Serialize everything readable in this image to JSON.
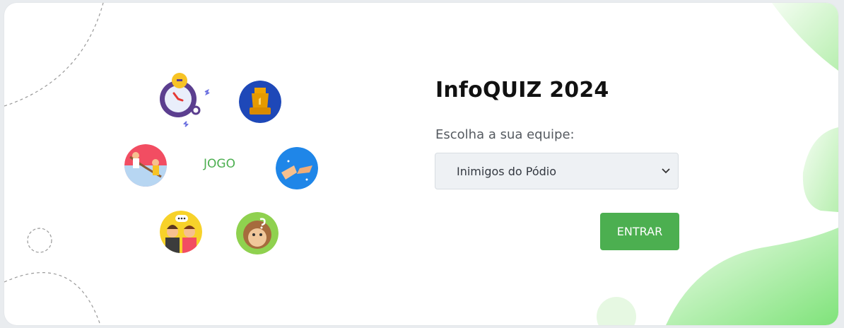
{
  "quiz": {
    "title": "InfoQUIZ 2024",
    "center_label": "JOGO"
  },
  "form": {
    "team_label": "Escolha a sua equipe:",
    "team_selected": "Inimigos do Pódio",
    "submit_label": "ENTRAR"
  },
  "icons": [
    "stopwatch-icon",
    "trophy-icon",
    "fistbump-icon",
    "thinking-monkey-icon",
    "friends-chat-icon",
    "tug-of-war-icon"
  ],
  "colors": {
    "accent": "#4caf50",
    "background": "#ffffff",
    "select_bg": "#eef1f4"
  }
}
